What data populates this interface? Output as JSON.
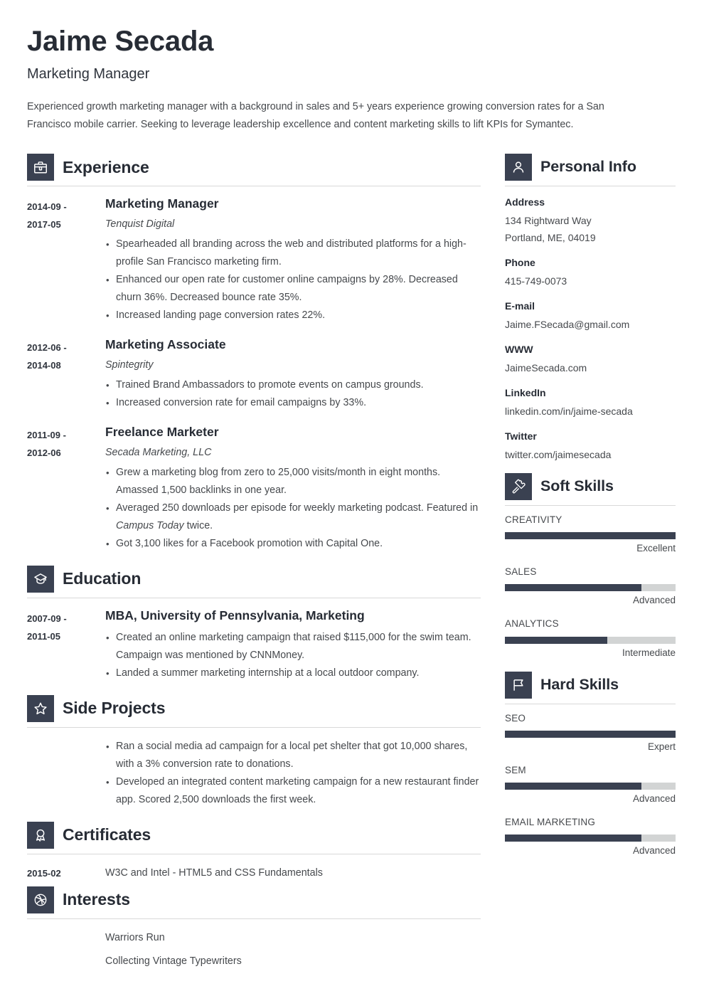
{
  "header": {
    "name": "Jaime Secada",
    "job_title": "Marketing Manager",
    "summary": "Experienced growth marketing manager with a background in sales and 5+ years experience growing conversion rates for a San Francisco mobile carrier. Seeking to leverage leadership excellence and content marketing skills to lift KPIs for Symantec."
  },
  "sections": {
    "experience": {
      "title": "Experience",
      "icon": "briefcase-icon",
      "entries": [
        {
          "dates": "2014-09 - 2017-05",
          "date_start": "2014-09 -",
          "date_end": "2017-05",
          "role": "Marketing Manager",
          "company": "Tenquist Digital",
          "bullets": [
            "Spearheaded all branding across the web and distributed platforms for a high-profile San Francisco marketing firm.",
            "Enhanced our open rate for customer online campaigns by 28%. Decreased churn 36%. Decreased bounce rate 35%.",
            "Increased landing page conversion rates 22%."
          ]
        },
        {
          "dates": "2012-06 - 2014-08",
          "date_start": "2012-06 -",
          "date_end": "2014-08",
          "role": "Marketing Associate",
          "company": "Spintegrity",
          "bullets": [
            "Trained Brand Ambassadors to promote events on campus grounds.",
            "Increased conversion rate for email campaigns by 33%."
          ]
        },
        {
          "dates": "2011-09 - 2012-06",
          "date_start": "2011-09 -",
          "date_end": "2012-06",
          "role": "Freelance Marketer",
          "company": "Secada Marketing, LLC",
          "bullets": [
            "Grew a marketing blog from zero to 25,000 visits/month in eight months. Amassed 1,500 backlinks in one year.",
            "Averaged 250 downloads per episode for weekly marketing podcast. Featured in Campus Today twice.",
            "Got 3,100 likes for a Facebook promotion with Capital One."
          ],
          "bullet_italic_2": "Campus Today"
        }
      ]
    },
    "education": {
      "title": "Education",
      "icon": "graduation-cap-icon",
      "entries": [
        {
          "date_start": "2007-09 -",
          "date_end": "2011-05",
          "degree": "MBA, University of Pennsylvania, Marketing",
          "bullets": [
            "Created an online marketing campaign that raised $115,000 for the swim team. Campaign was mentioned by CNNMoney.",
            "Landed a summer marketing internship at a local outdoor company."
          ]
        }
      ]
    },
    "side_projects": {
      "title": "Side Projects",
      "icon": "star-icon",
      "bullets": [
        "Ran a social media ad campaign for a local pet shelter that got 10,000 shares, with a 3% conversion rate to donations.",
        "Developed an integrated content marketing campaign for a new restaurant finder app. Scored 2,500 downloads the first week."
      ]
    },
    "certificates": {
      "title": "Certificates",
      "icon": "award-icon",
      "entries": [
        {
          "date": "2015-02",
          "text": "W3C and Intel - HTML5 and CSS Fundamentals"
        }
      ]
    },
    "interests": {
      "title": "Interests",
      "icon": "ball-icon",
      "items": [
        "Warriors Run",
        "Collecting Vintage Typewriters"
      ]
    },
    "personal_info": {
      "title": "Personal Info",
      "icon": "person-icon",
      "fields": [
        {
          "label": "Address",
          "value": "134 Rightward Way",
          "value2": "Portland, ME, 04019"
        },
        {
          "label": "Phone",
          "value": "415-749-0073"
        },
        {
          "label": "E-mail",
          "value": "Jaime.FSecada@gmail.com"
        },
        {
          "label": "WWW",
          "value": "JaimeSecada.com"
        },
        {
          "label": "LinkedIn",
          "value": "linkedin.com/in/jaime-secada"
        },
        {
          "label": "Twitter",
          "value": "twitter.com/jaimesecada"
        }
      ]
    },
    "soft_skills": {
      "title": "Soft Skills",
      "icon": "puzzle-icon",
      "skills": [
        {
          "name": "CREATIVITY",
          "level": "Excellent",
          "percent": 100
        },
        {
          "name": "SALES",
          "level": "Advanced",
          "percent": 80
        },
        {
          "name": "ANALYTICS",
          "level": "Intermediate",
          "percent": 60
        }
      ]
    },
    "hard_skills": {
      "title": "Hard Skills",
      "icon": "flag-icon",
      "skills": [
        {
          "name": "SEO",
          "level": "Expert",
          "percent": 100
        },
        {
          "name": "SEM",
          "level": "Advanced",
          "percent": 80
        },
        {
          "name": "EMAIL MARKETING",
          "level": "Advanced",
          "percent": 80
        }
      ]
    }
  },
  "colors": {
    "accent_dark": "#3a4151",
    "heading": "#272c35",
    "body_text": "#46494d",
    "rule": "#d9d9d9",
    "track": "#d2d4d4"
  }
}
